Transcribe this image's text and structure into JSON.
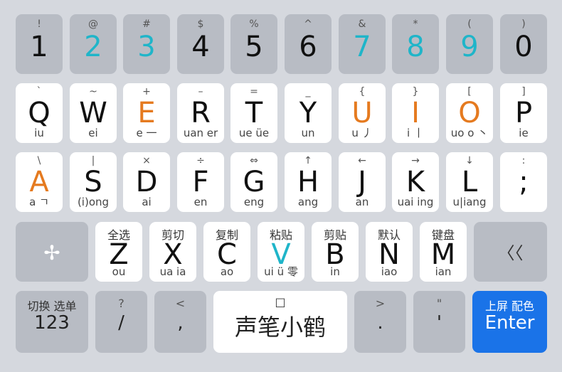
{
  "row1": [
    {
      "sym": "!",
      "key": "1"
    },
    {
      "sym": "@",
      "key": "2"
    },
    {
      "sym": "#",
      "key": "3"
    },
    {
      "sym": "$",
      "key": "4"
    },
    {
      "sym": "%",
      "key": "5"
    },
    {
      "sym": "^",
      "key": "6"
    },
    {
      "sym": "&",
      "key": "7"
    },
    {
      "sym": "*",
      "key": "8"
    },
    {
      "sym": "(",
      "key": "9"
    },
    {
      "sym": ")",
      "key": "0"
    }
  ],
  "row2": [
    {
      "sym": "`",
      "key": "Q",
      "hint": "iu"
    },
    {
      "sym": "~",
      "key": "W",
      "hint": "ei"
    },
    {
      "sym": "+",
      "key": "E",
      "hint": "e 一"
    },
    {
      "sym": "–",
      "key": "R",
      "hint": "uan er"
    },
    {
      "sym": "=",
      "key": "T",
      "hint": "ue üe"
    },
    {
      "sym": "_",
      "key": "Y",
      "hint": "un"
    },
    {
      "sym": "{",
      "key": "U",
      "hint": "u 丿"
    },
    {
      "sym": "}",
      "key": "I",
      "hint": "i 丨"
    },
    {
      "sym": "[",
      "key": "O",
      "hint": "uo o 丶"
    },
    {
      "sym": "]",
      "key": "P",
      "hint": "ie"
    }
  ],
  "row3": [
    {
      "sym": "\\",
      "key": "A",
      "hint": "a ㄱ"
    },
    {
      "sym": "|",
      "key": "S",
      "hint": "(i)ong"
    },
    {
      "sym": "×",
      "key": "D",
      "hint": "ai"
    },
    {
      "sym": "÷",
      "key": "F",
      "hint": "en"
    },
    {
      "sym": "⇔",
      "key": "G",
      "hint": "eng"
    },
    {
      "sym": "↑",
      "key": "H",
      "hint": "ang"
    },
    {
      "sym": "←",
      "key": "J",
      "hint": "an"
    },
    {
      "sym": "→",
      "key": "K",
      "hint": "uai ing"
    },
    {
      "sym": "↓",
      "key": "L",
      "hint": "u|iang"
    },
    {
      "sym": ":",
      "key": ";",
      "hint": ""
    }
  ],
  "row4": [
    {
      "top": "全选",
      "key": "Z",
      "hint": "ou"
    },
    {
      "top": "剪切",
      "key": "X",
      "hint": "ua ia"
    },
    {
      "top": "复制",
      "key": "C",
      "hint": "ao"
    },
    {
      "top": "粘贴",
      "key": "V",
      "hint": "ui ü 零"
    },
    {
      "top": "剪贴",
      "key": "B",
      "hint": "in"
    },
    {
      "top": "默认",
      "key": "N",
      "hint": "iao"
    },
    {
      "top": "键盘",
      "key": "M",
      "hint": "ian"
    }
  ],
  "row5": {
    "numkey": {
      "top": "切换  选单",
      "main": "123"
    },
    "slash": {
      "top": "?",
      "main": "/"
    },
    "comma": {
      "top": "<",
      "main": ","
    },
    "space": {
      "top": "□",
      "main": "声笔小鹤"
    },
    "period": {
      "top": ">",
      "main": "."
    },
    "quote": {
      "top": "\"",
      "main": "'"
    },
    "enter": {
      "top": "上屏  配色",
      "main": "Enter"
    }
  },
  "shift_symbol": "✢",
  "backspace_symbol": "〈〈",
  "colors": {
    "orange": "#e57a1f",
    "teal": "#1fb5c9",
    "enter_bg": "#1a73e8"
  }
}
